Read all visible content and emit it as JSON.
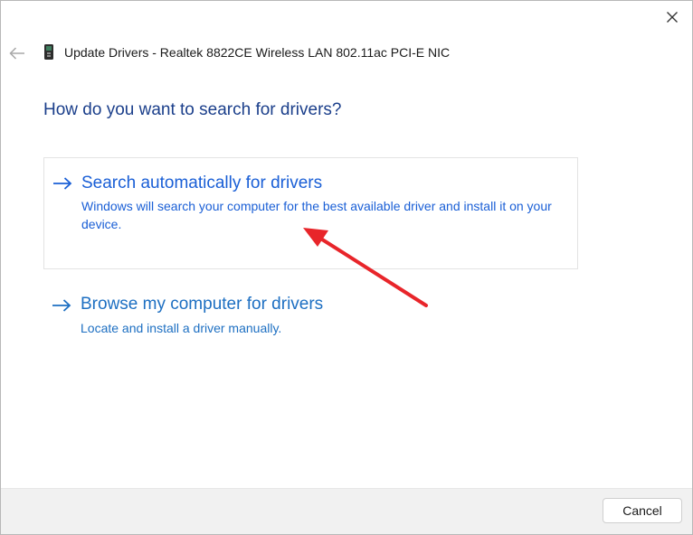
{
  "dialog": {
    "title": "Update Drivers - Realtek 8822CE Wireless LAN 802.11ac PCI-E NIC",
    "heading": "How do you want to search for drivers?"
  },
  "options": [
    {
      "title": "Search automatically for drivers",
      "description": "Windows will search your computer for the best available driver and install it on your device."
    },
    {
      "title": "Browse my computer for drivers",
      "description": "Locate and install a driver manually."
    }
  ],
  "footer": {
    "cancel_label": "Cancel"
  },
  "colors": {
    "heading": "#1b3f8b",
    "option1_accent": "#1a5fd6",
    "option2_accent": "#1d6fc2",
    "annotation_arrow": "#e8252a"
  },
  "icons": {
    "close": "close-icon",
    "back": "back-arrow-icon",
    "device": "network-adapter-icon",
    "option": "right-arrow-icon"
  }
}
